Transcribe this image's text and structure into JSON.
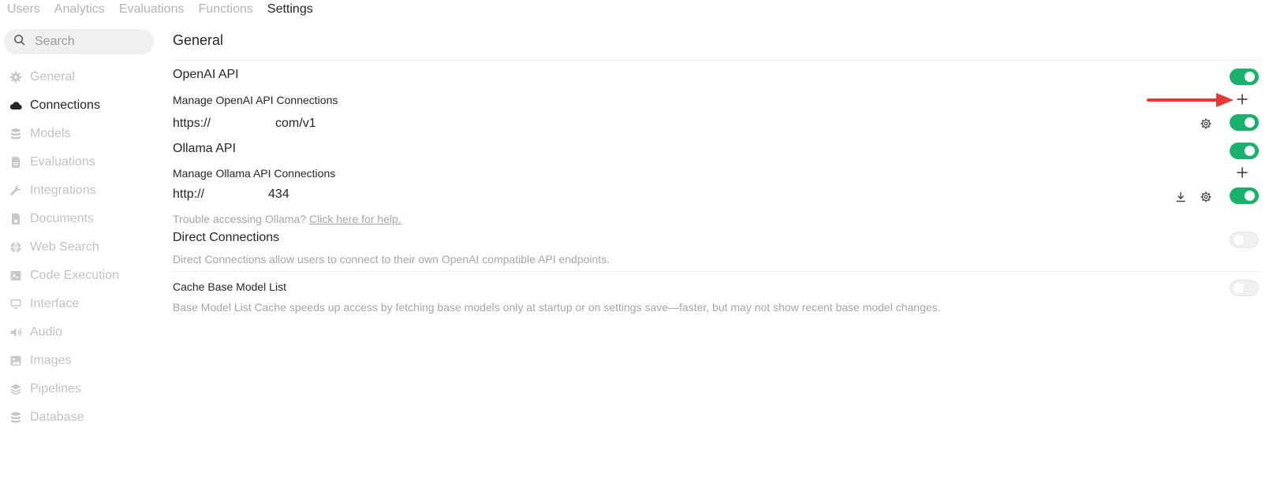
{
  "topnav": {
    "tabs": [
      "Users",
      "Analytics",
      "Evaluations",
      "Functions",
      "Settings"
    ]
  },
  "search": {
    "placeholder": "Search"
  },
  "sidebar": {
    "items": [
      {
        "label": "General",
        "icon": "gear-icon"
      },
      {
        "label": "Connections",
        "icon": "cloud-icon"
      },
      {
        "label": "Models",
        "icon": "stack-icon"
      },
      {
        "label": "Evaluations",
        "icon": "document-icon"
      },
      {
        "label": "Integrations",
        "icon": "wrench-icon"
      },
      {
        "label": "Documents",
        "icon": "document-lock-icon"
      },
      {
        "label": "Web Search",
        "icon": "globe-icon"
      },
      {
        "label": "Code Execution",
        "icon": "terminal-icon"
      },
      {
        "label": "Interface",
        "icon": "monitor-icon"
      },
      {
        "label": "Audio",
        "icon": "speaker-icon"
      },
      {
        "label": "Images",
        "icon": "image-icon"
      },
      {
        "label": "Pipelines",
        "icon": "layers-icon"
      },
      {
        "label": "Database",
        "icon": "database-icon"
      }
    ]
  },
  "main": {
    "title": "General",
    "openai": {
      "title": "OpenAI API",
      "manage_label": "Manage OpenAI API Connections",
      "url_prefix": "https://",
      "url_suffix": "com/v1"
    },
    "ollama": {
      "title": "Ollama API",
      "manage_label": "Manage Ollama API Connections",
      "url_prefix": "http://",
      "url_suffix": "434",
      "help_text": "Trouble accessing Ollama?",
      "help_link": "Click here for help."
    },
    "direct": {
      "title": "Direct Connections",
      "description": "Direct Connections allow users to connect to their own OpenAI compatible API endpoints."
    },
    "cache": {
      "title": "Cache Base Model List",
      "description": "Base Model List Cache speeds up access by fetching base models only at startup or on settings save—faster, but may not show recent base model changes."
    }
  },
  "colors": {
    "toggle_on": "#18b26a",
    "arrow": "#e53935"
  }
}
